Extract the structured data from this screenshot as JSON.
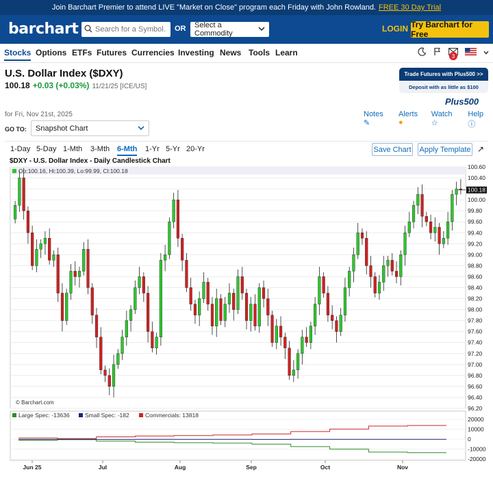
{
  "banner": {
    "text": "Join Barchart Premier to attend LIVE \"Market on Close\" program each Friday with John Rowland.",
    "link": "FREE 30 Day Trial"
  },
  "header": {
    "logo": "barchart",
    "search_placeholder": "Search for a Symbol...",
    "or_label": "OR",
    "commodity_label": "Select a Commodity",
    "login": "LOGIN",
    "try_button": "Try Barchart for Free"
  },
  "nav": {
    "items": [
      "Stocks",
      "Options",
      "ETFs",
      "Futures",
      "Currencies",
      "Investing",
      "News",
      "Tools",
      "Learn"
    ],
    "notification_count": "3"
  },
  "quote": {
    "title": "U.S. Dollar Index ($DXY)",
    "last": "100.18",
    "change": "+0.03 (+0.03%)",
    "meta": "11/21/25 [ICE/US]",
    "for_date": "for Fri, Nov 21st, 2025"
  },
  "ad": {
    "line1": "Trade Futures with Plus500 >>",
    "line2": "Deposit with as little as $100",
    "brand": "Plus500"
  },
  "actions": {
    "notes": "Notes",
    "alerts": "Alerts",
    "watch": "Watch",
    "help": "Help"
  },
  "goto": {
    "label": "GO TO:",
    "value": "Snapshot Chart"
  },
  "periods": [
    "1-Day",
    "5-Day",
    "1-Mth",
    "3-Mth",
    "6-Mth",
    "1-Yr",
    "5-Yr",
    "20-Yr"
  ],
  "active_period": "6-Mth",
  "buttons": {
    "save": "Save Chart",
    "template": "Apply Template"
  },
  "colors": {
    "up": "#2ec72e",
    "down": "#d12121",
    "brand": "#0d4a91",
    "accent": "#f4c20d"
  },
  "chart_data": [
    {
      "type": "candlestick",
      "title": "$DXY - U.S. Dollar Index - Daily Candlestick Chart",
      "ohlc_label": "Op:100.16, Hi:100.39, Lo:99.99, Cl:100.18",
      "last_label": "100.18",
      "watermark": "© Barchart.com",
      "y_ticks": [
        "100.60",
        "100.40",
        "100.20",
        "100.00",
        "99.80",
        "99.60",
        "99.40",
        "99.20",
        "99.00",
        "98.80",
        "98.60",
        "98.40",
        "98.20",
        "98.00",
        "97.80",
        "97.60",
        "97.40",
        "97.20",
        "97.00",
        "96.80",
        "96.60",
        "96.40",
        "96.20"
      ],
      "ylim": [
        96.2,
        100.6
      ],
      "x_labels": [
        "Jun 25",
        "Jul",
        "Aug",
        "Sep",
        "Oct",
        "Nov"
      ],
      "closes": [
        99.9,
        100.4,
        99.8,
        99.4,
        98.8,
        99.1,
        99.2,
        99.3,
        98.9,
        99.0,
        98.3,
        97.8,
        98.3,
        98.7,
        98.6,
        98.7,
        99.1,
        98.4,
        97.9,
        97.5,
        96.9,
        96.8,
        96.6,
        97.0,
        97.2,
        97.5,
        97.8,
        98.0,
        98.4,
        98.6,
        98.3,
        97.6,
        97.3,
        97.5,
        98.9,
        99.0,
        99.6,
        100.0,
        99.3,
        98.9,
        98.4,
        98.1,
        97.9,
        98.2,
        98.5,
        98.1,
        97.7,
        98.2,
        97.8,
        98.1,
        98.3,
        98.0,
        98.6,
        98.3,
        97.8,
        98.1,
        97.7,
        98.4,
        98.2,
        97.9,
        97.4,
        97.7,
        97.5,
        97.3,
        96.8,
        96.9,
        97.2,
        97.5,
        97.4,
        97.7,
        98.1,
        98.6,
        98.3,
        97.9,
        97.8,
        97.6,
        97.9,
        98.4,
        98.7,
        99.0,
        99.4,
        99.3,
        98.8,
        98.6,
        98.3,
        98.5,
        98.8,
        98.9,
        98.7,
        98.6,
        99.0,
        99.4,
        99.6,
        99.9,
        100.1,
        99.7,
        99.6,
        99.4,
        99.5,
        99.2,
        99.3,
        99.6,
        100.1,
        100.2,
        100.18
      ],
      "lower_panel": {
        "legend": [
          "Large Spec: -13636",
          "Small Spec: -182",
          "Commercials: 13818"
        ],
        "y_ticks": [
          "20000",
          "10000",
          "0",
          "-10000",
          "-20000"
        ],
        "series": [
          {
            "name": "Large Spec",
            "color": "#2e8b2e",
            "values": [
              -1000,
              -500,
              -2000,
              -3000,
              -3500,
              -4000,
              -5000,
              -7500,
              -10000,
              -13000,
              -13636
            ]
          },
          {
            "name": "Small Spec",
            "color": "#1a237e",
            "values": [
              -200,
              -100,
              -300,
              -200,
              -150,
              -200,
              -250,
              -180,
              -160,
              -182,
              -182
            ]
          },
          {
            "name": "Commercials",
            "color": "#c62828",
            "values": [
              1200,
              600,
              2300,
              3200,
              3650,
              4200,
              5250,
              7700,
              10200,
              13200,
              13818
            ]
          }
        ]
      }
    }
  ]
}
